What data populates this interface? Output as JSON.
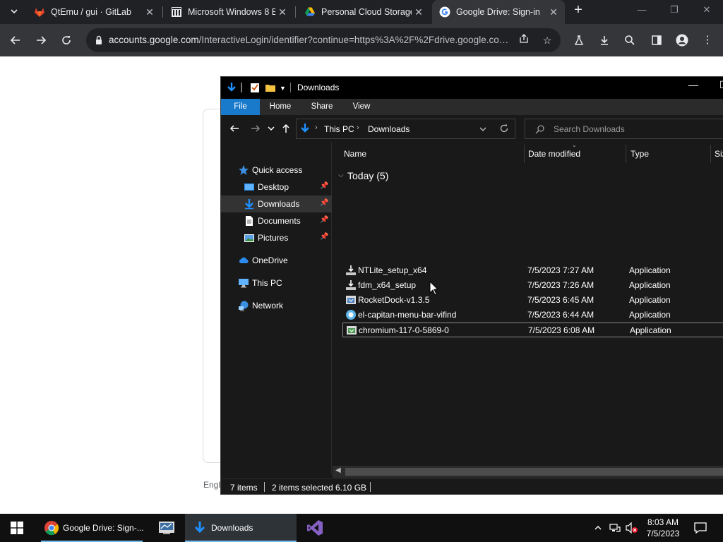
{
  "browser": {
    "tabs": [
      {
        "title": "QtEmu / gui · GitLab",
        "active": false
      },
      {
        "title": "Microsoft Windows 8 B",
        "active": false
      },
      {
        "title": "Personal Cloud Storage",
        "active": false
      },
      {
        "title": "Google Drive: Sign-in",
        "active": true
      }
    ],
    "url_host": "accounts.google.com",
    "url_path": "/InteractiveLogin/identifier?continue=https%3A%2F%2Fdrive.google.com..."
  },
  "page_behind": {
    "language_label": "Engl"
  },
  "explorer": {
    "title": "Downloads",
    "ribbon_tabs": [
      "File",
      "Home",
      "Share",
      "View"
    ],
    "breadcrumb": [
      "This PC",
      "Downloads"
    ],
    "search_placeholder": "Search Downloads",
    "nav_items": [
      {
        "label": "Quick access",
        "icon": "star-icon",
        "pinned": false
      },
      {
        "label": "Desktop",
        "icon": "desktop-icon",
        "pinned": true
      },
      {
        "label": "Downloads",
        "icon": "download-arrow-icon",
        "pinned": true,
        "selected": true
      },
      {
        "label": "Documents",
        "icon": "document-icon",
        "pinned": true
      },
      {
        "label": "Pictures",
        "icon": "pictures-icon",
        "pinned": true
      },
      {
        "label": "OneDrive",
        "icon": "cloud-icon",
        "pinned": false
      },
      {
        "label": "This PC",
        "icon": "computer-icon",
        "pinned": false
      },
      {
        "label": "Network",
        "icon": "network-icon",
        "pinned": false
      }
    ],
    "columns": [
      "Name",
      "Date modified",
      "Type",
      "Siz"
    ],
    "group_label": "Today (5)",
    "files": [
      {
        "name": "NTLite_setup_x64",
        "date": "7/5/2023 7:27 AM",
        "type": "Application",
        "icon": "installer-icon"
      },
      {
        "name": "fdm_x64_setup",
        "date": "7/5/2023 7:26 AM",
        "type": "Application",
        "icon": "installer-icon"
      },
      {
        "name": "RocketDock-v1.3.5",
        "date": "7/5/2023 6:45 AM",
        "type": "Application",
        "icon": "setup-box-icon"
      },
      {
        "name": "el-capitan-menu-bar-vifind",
        "date": "7/5/2023 6:44 AM",
        "type": "Application",
        "icon": "app-disc-icon"
      },
      {
        "name": "chromium-117-0-5869-0",
        "date": "7/5/2023 6:08 AM",
        "type": "Application",
        "icon": "setup-box-icon",
        "selected": true
      }
    ],
    "status": {
      "items": "7 items",
      "selected": "2 items selected",
      "size": "6.10 GB"
    }
  },
  "taskbar": {
    "apps": [
      {
        "label": "Google Drive: Sign-...",
        "icon": "chrome-icon",
        "active": false
      },
      {
        "label": "",
        "icon": "control-panel-icon",
        "active": false
      },
      {
        "label": "Downloads",
        "icon": "file-explorer-icon",
        "active": true
      },
      {
        "label": "",
        "icon": "visual-studio-icon",
        "active": false
      }
    ],
    "time": "8:03 AM",
    "date": "7/5/2023"
  }
}
